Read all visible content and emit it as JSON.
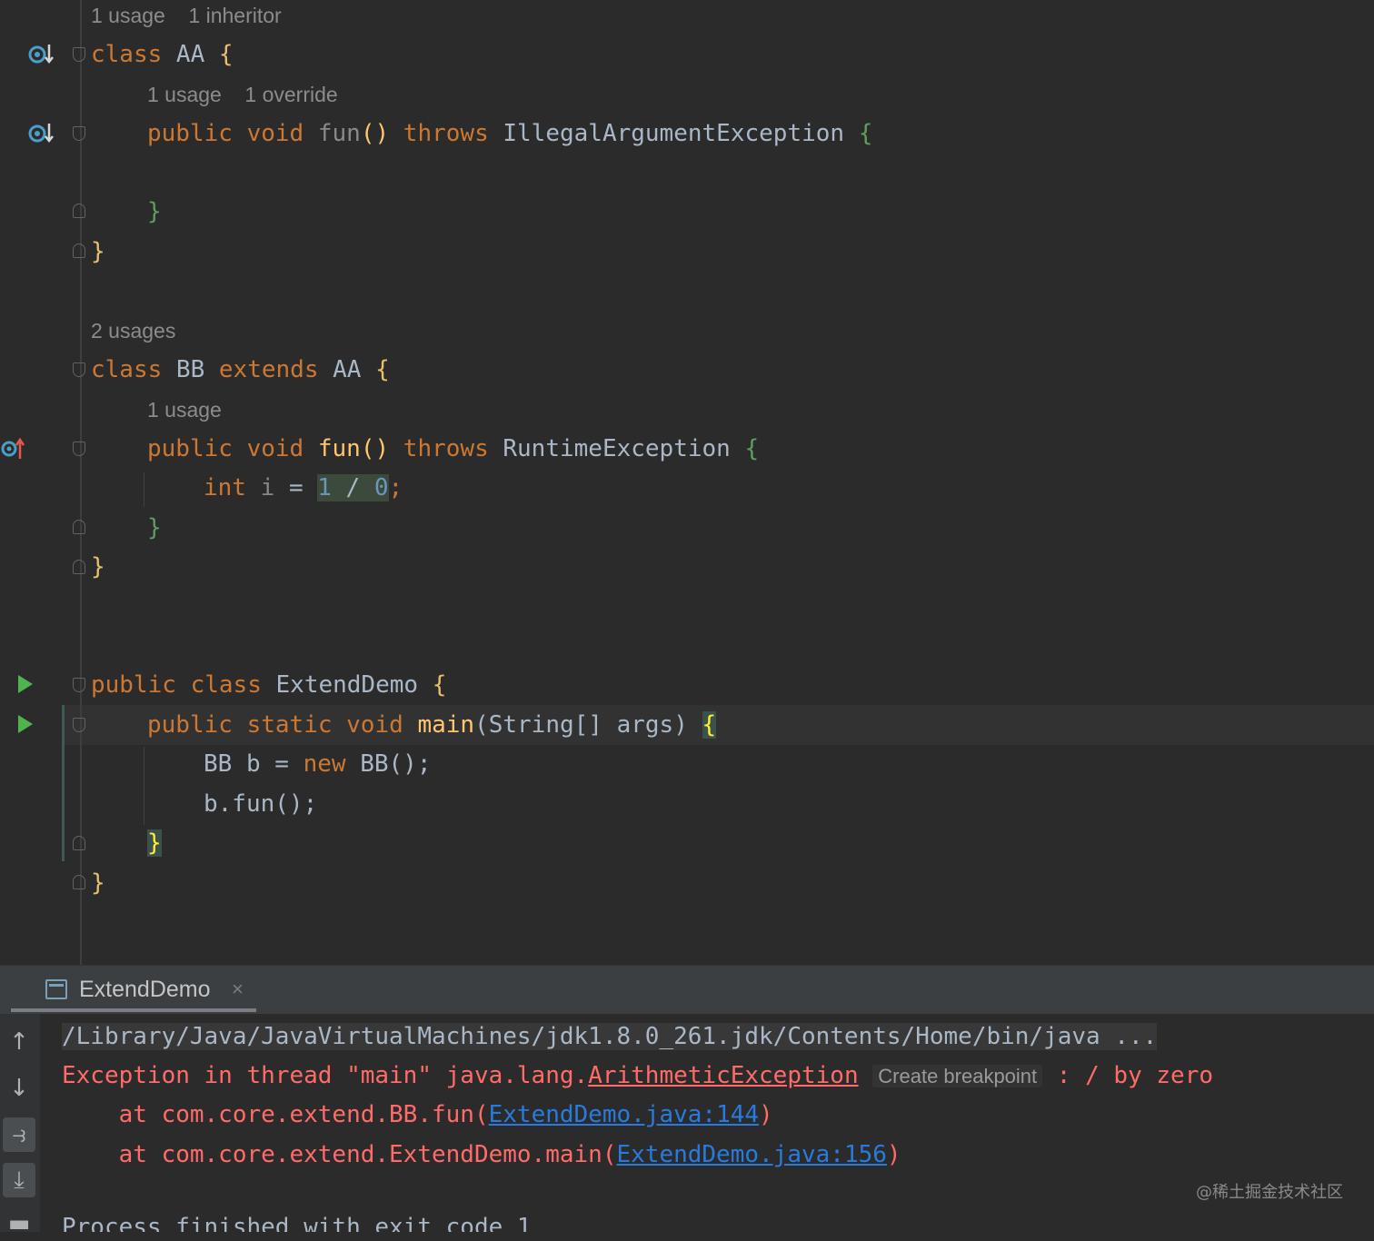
{
  "editor": {
    "lens": {
      "aa_class": "1 usage    1 inheritor",
      "aa_fun": "1 usage    1 override",
      "bb_class": "2 usages",
      "bb_fun": "1 usage"
    },
    "lines": {
      "aa_class": {
        "kw": "class",
        "name": " AA ",
        "brace": "{"
      },
      "aa_fun": {
        "kw1": "public",
        "kw2": "void",
        "name": "fun",
        "parens": "()",
        "kw3": "throws",
        "type": " IllegalArgumentException ",
        "brace": "{"
      },
      "aa_fun_close": "}",
      "aa_close": "}",
      "bb_class": {
        "kw1": "class",
        "name": " BB ",
        "kw2": "extends",
        "super": " AA ",
        "brace": "{"
      },
      "bb_fun": {
        "kw1": "public",
        "kw2": "void",
        "name": "fun",
        "parens": "()",
        "kw3": "throws",
        "type": " RuntimeException ",
        "brace": "{"
      },
      "bb_body": {
        "kw": "int",
        "var": " i ",
        "eq": "= ",
        "n1": "1",
        "op": " / ",
        "n2": "0",
        "semi": ";"
      },
      "bb_fun_close": "}",
      "bb_close": "}",
      "demo_class": {
        "kw1": "public",
        "kw2": "class",
        "name": " ExtendDemo ",
        "brace": "{"
      },
      "main": {
        "kw1": "public",
        "kw2": "static",
        "kw3": "void",
        "name": "main",
        "sig": "(String[] args) ",
        "brace": "{"
      },
      "body1": {
        "type": "BB b = ",
        "kw": "new",
        "rest": " BB();"
      },
      "body2": "b.fun();",
      "main_close": "}",
      "demo_close": "}"
    }
  },
  "run_panel": {
    "tab_label": "ExtendDemo",
    "tab_close": "×",
    "toolbar": {
      "up": "↑",
      "down": "↓",
      "wrap": "⥽",
      "scroll_end": "⤓",
      "print": "▬"
    },
    "console": {
      "command": "/Library/Java/JavaVirtualMachines/jdk1.8.0_261.jdk/Contents/Home/bin/java ...",
      "exception_prefix": "Exception in thread \"main\" java.lang.",
      "exception_class": "ArithmeticException",
      "create_breakpoint": "Create breakpoint",
      "exception_suffix": " : / by zero",
      "trace1_prefix": "    at com.core.extend.BB.fun(",
      "trace1_link": "ExtendDemo.java:144",
      "trace1_suffix": ")",
      "trace2_prefix": "    at com.core.extend.ExtendDemo.main(",
      "trace2_link": "ExtendDemo.java:156",
      "trace2_suffix": ")",
      "exit": "Process finished with exit code 1"
    }
  },
  "watermark": "@稀土掘金技术社区"
}
